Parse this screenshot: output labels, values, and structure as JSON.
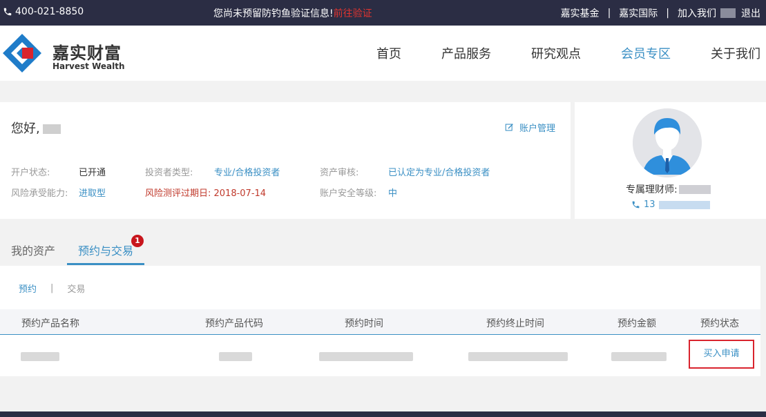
{
  "topbar": {
    "phone": "400-021-8850",
    "notice_text": "您尚未预留防钓鱼验证信息!",
    "notice_link": "前往验证",
    "links": [
      "嘉实基金",
      "嘉实国际",
      "加入我们",
      "退出"
    ],
    "separator": "|"
  },
  "header": {
    "logo_cn": "嘉实财富",
    "logo_en": "Harvest Wealth",
    "nav": [
      "首页",
      "产品服务",
      "研究观点",
      "会员专区",
      "关于我们"
    ],
    "nav_active": "会员专区"
  },
  "account": {
    "greeting": "您好,",
    "manage_label": "账户管理",
    "fields": {
      "open_status_label": "开户状态:",
      "open_status_value": "已开通",
      "investor_type_label": "投资者类型:",
      "investor_type_value": "专业/合格投资者",
      "asset_review_label": "资产审核:",
      "asset_review_value": "已认定为专业/合格投资者",
      "risk_label": "风险承受能力:",
      "risk_value": "进取型",
      "risk_expire": "风险测评过期日: 2018-07-14",
      "security_label": "账户安全等级:",
      "security_value": "中"
    }
  },
  "advisor": {
    "label": "专属理财师:",
    "phone_prefix": "13"
  },
  "tabs": {
    "items": [
      "我的资产",
      "预约与交易"
    ],
    "active": "预约与交易",
    "badge": "1"
  },
  "trade": {
    "subtabs": [
      "预约",
      "交易"
    ],
    "subtab_active": "预约",
    "subtab_separator": "|",
    "columns": [
      "预约产品名称",
      "预约产品代码",
      "预约时间",
      "预约终止时间",
      "预约金额",
      "预约状态"
    ],
    "row_status": "买入申请"
  },
  "colors": {
    "topbar_bg": "#2b2d44",
    "accent": "#3a8fc4",
    "alert_red": "#e0342f",
    "badge_red": "#c8161d",
    "highlight_border": "#d9232d"
  }
}
